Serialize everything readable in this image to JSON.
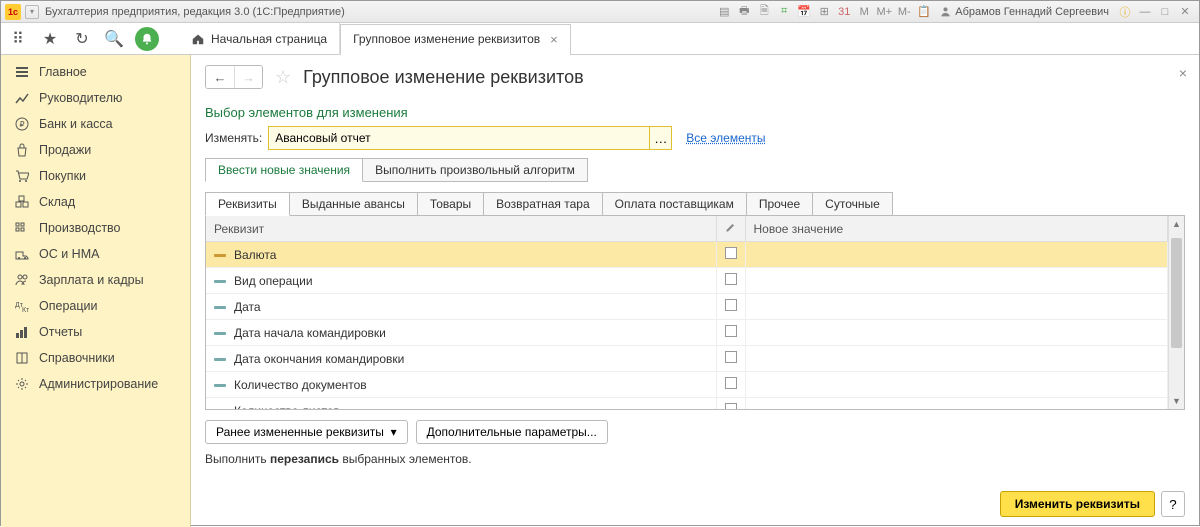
{
  "titlebar": {
    "app_title": "Бухгалтерия предприятия, редакция 3.0 (1С:Предприятие)",
    "user_name": "Абрамов Геннадий Сергеевич",
    "markers": [
      "M",
      "M+",
      "M-"
    ]
  },
  "toolbar": {
    "home_tab": "Начальная страница",
    "active_tab": "Групповое изменение реквизитов"
  },
  "sidebar": {
    "items": [
      {
        "label": "Главное",
        "icon": "menu"
      },
      {
        "label": "Руководителю",
        "icon": "chart"
      },
      {
        "label": "Банк и касса",
        "icon": "ruble"
      },
      {
        "label": "Продажи",
        "icon": "bag"
      },
      {
        "label": "Покупки",
        "icon": "cart"
      },
      {
        "label": "Склад",
        "icon": "boxes"
      },
      {
        "label": "Производство",
        "icon": "factory"
      },
      {
        "label": "ОС и НМА",
        "icon": "truck"
      },
      {
        "label": "Зарплата и кадры",
        "icon": "people"
      },
      {
        "label": "Операции",
        "icon": "ops"
      },
      {
        "label": "Отчеты",
        "icon": "bars"
      },
      {
        "label": "Справочники",
        "icon": "book"
      },
      {
        "label": "Администрирование",
        "icon": "gear"
      }
    ]
  },
  "content": {
    "page_title": "Групповое изменение реквизитов",
    "section_title": "Выбор элементов для изменения",
    "change_label": "Изменять:",
    "change_value": "Авансовый отчет",
    "all_elements_link": "Все элементы",
    "mode_tabs": [
      "Ввести новые значения",
      "Выполнить произвольный алгоритм"
    ],
    "sub_tabs": [
      "Реквизиты",
      "Выданные авансы",
      "Товары",
      "Возвратная тара",
      "Оплата поставщикам",
      "Прочее",
      "Суточные"
    ],
    "grid": {
      "col1": "Реквизит",
      "col2": "Новое значение",
      "rows": [
        {
          "label": "Валюта",
          "selected": true
        },
        {
          "label": "Вид операции"
        },
        {
          "label": "Дата"
        },
        {
          "label": "Дата начала командировки"
        },
        {
          "label": "Дата окончания командировки"
        },
        {
          "label": "Количество документов"
        },
        {
          "label": "Количество листов"
        }
      ]
    },
    "prev_button": "Ранее измененные реквизиты",
    "extra_button": "Дополнительные параметры...",
    "hint_pre": "Выполнить ",
    "hint_bold": "перезапись",
    "hint_post": " выбранных элементов.",
    "primary_button": "Изменить реквизиты",
    "help_button": "?"
  }
}
